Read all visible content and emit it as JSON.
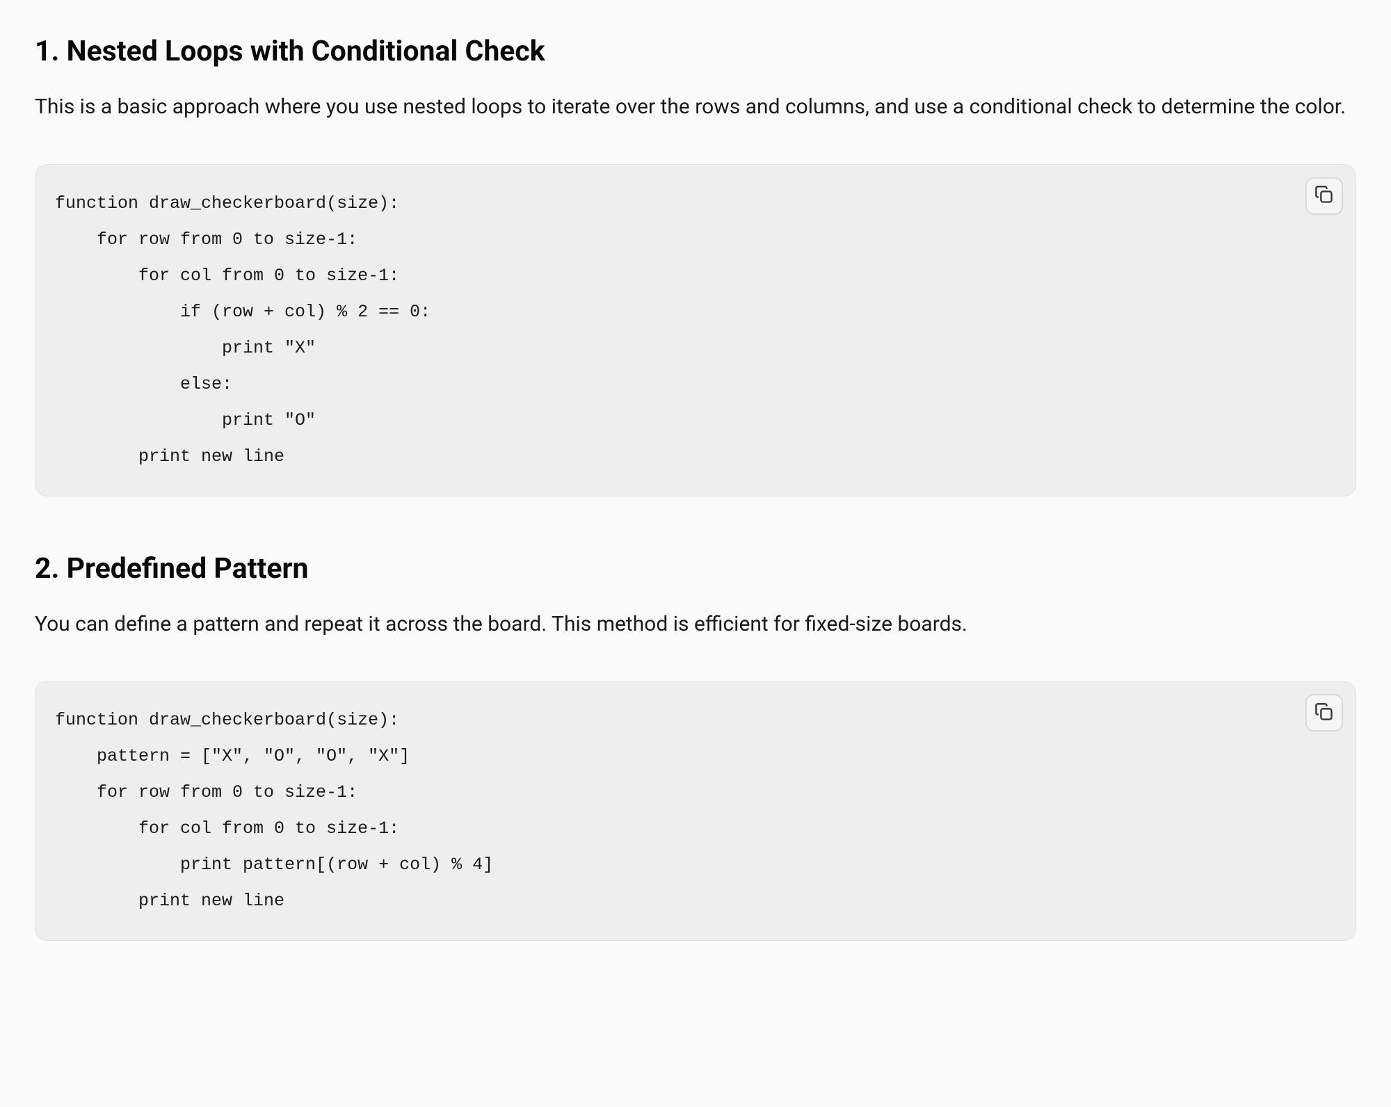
{
  "sections": [
    {
      "heading": "1. Nested Loops with Conditional Check",
      "description": "This is a basic approach where you use nested loops to iterate over the rows and columns, and use a conditional check to determine the color.",
      "code": "function draw_checkerboard(size):\n    for row from 0 to size-1:\n        for col from 0 to size-1:\n            if (row + col) % 2 == 0:\n                print \"X\"\n            else:\n                print \"O\"\n        print new line"
    },
    {
      "heading": "2. Predefined Pattern",
      "description": "You can define a pattern and repeat it across the board. This method is efficient for fixed-size boards.",
      "code": "function draw_checkerboard(size):\n    pattern = [\"X\", \"O\", \"O\", \"X\"]\n    for row from 0 to size-1:\n        for col from 0 to size-1:\n            print pattern[(row + col) % 4]\n        print new line"
    }
  ]
}
